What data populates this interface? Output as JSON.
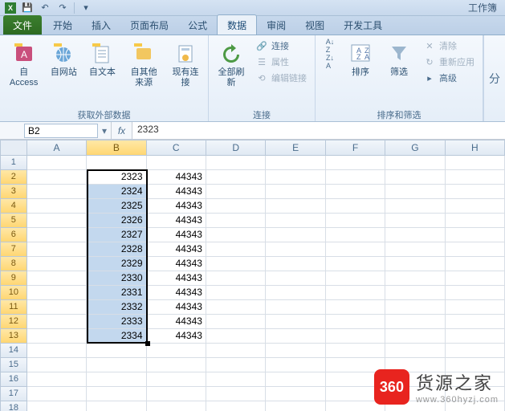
{
  "title_right": "工作簿",
  "qat": {
    "undo": "↶",
    "redo": "↷",
    "save_glyph": "💾",
    "excel_glyph": "X"
  },
  "tabs": {
    "file": "文件",
    "home": "开始",
    "insert": "插入",
    "layout": "页面布局",
    "formula": "公式",
    "data": "数据",
    "review": "审阅",
    "view": "视图",
    "dev": "开发工具"
  },
  "ribbon": {
    "group1": {
      "label": "获取外部数据",
      "access": "自 Access",
      "web": "自网站",
      "text": "自文本",
      "other": "自其他来源",
      "existing": "现有连接"
    },
    "group2": {
      "label": "连接",
      "refresh": "全部刷新",
      "connections": "连接",
      "properties": "属性",
      "editlinks": "编辑链接"
    },
    "group3": {
      "label": "排序和筛选",
      "sort_az": "A→Z",
      "sort_za": "Z→A",
      "sort": "排序",
      "filter": "筛选",
      "clear": "清除",
      "reapply": "重新应用",
      "advanced": "高级"
    },
    "group4": "分"
  },
  "namebox": "B2",
  "formula": "2323",
  "columns": [
    "A",
    "B",
    "C",
    "D",
    "E",
    "F",
    "G",
    "H"
  ],
  "sel_col": "B",
  "sel_rows": [
    2,
    3,
    4,
    5,
    6,
    7,
    8,
    9,
    10,
    11,
    12,
    13
  ],
  "row_count": 18,
  "cells": {
    "B": {
      "2": "2323",
      "3": "2324",
      "4": "2325",
      "5": "2326",
      "6": "2327",
      "7": "2328",
      "8": "2329",
      "9": "2330",
      "10": "2331",
      "11": "2332",
      "12": "2333",
      "13": "2334"
    },
    "C": {
      "2": "44343",
      "3": "44343",
      "4": "44343",
      "5": "44343",
      "6": "44343",
      "7": "44343",
      "8": "44343",
      "9": "44343",
      "10": "44343",
      "11": "44343",
      "12": "44343",
      "13": "44343"
    }
  },
  "watermark": {
    "badge": "360",
    "line1": "货源之家",
    "line2": "www.360hyzj.com"
  }
}
